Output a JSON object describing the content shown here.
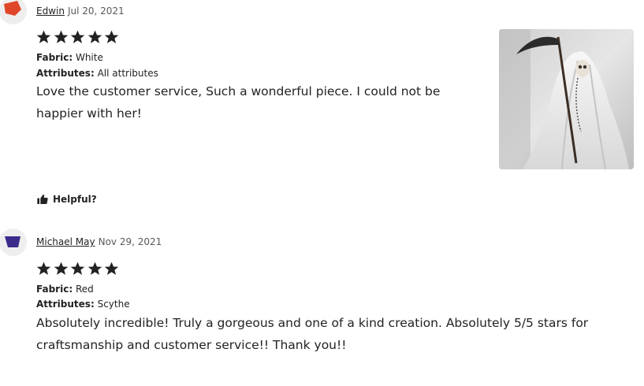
{
  "reviews": [
    {
      "author": "Edwin",
      "date": "Jul 20, 2021",
      "rating": 5,
      "fabric_label": "Fabric:",
      "fabric": "White",
      "attributes_label": "Attributes:",
      "attributes": "All attributes",
      "text": "Love the customer service, Such a wonderful piece. I could not be happier with her!",
      "helpful_label": "Helpful?",
      "avatar_color": "#e0472a"
    },
    {
      "author": "Michael May",
      "date": "Nov 29, 2021",
      "rating": 5,
      "fabric_label": "Fabric:",
      "fabric": "Red",
      "attributes_label": "Attributes:",
      "attributes": "Scythe",
      "text": "Absolutely incredible! Truly a gorgeous and one of a kind creation. Absolutely 5/5 stars for craftsmanship and customer service!! Thank you!!",
      "avatar_color": "#3b2a8a"
    }
  ],
  "colors": {
    "star": "#222222",
    "text": "#222222",
    "muted": "#595959"
  }
}
